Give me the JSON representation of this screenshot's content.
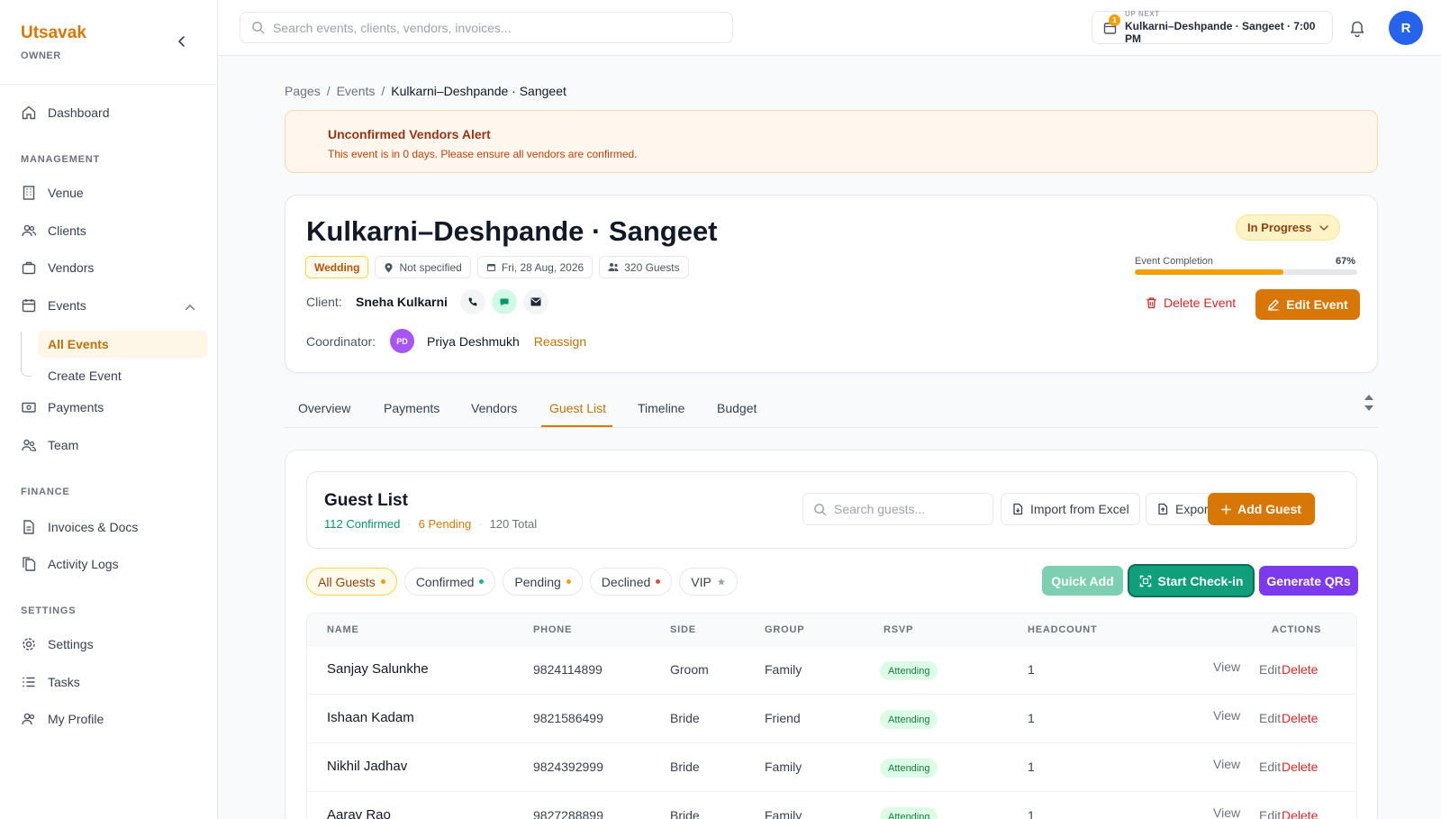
{
  "brand": {
    "name": "Utsavak",
    "role": "OWNER"
  },
  "sidebar": {
    "dashboard": "Dashboard",
    "management_label": "MANAGEMENT",
    "venue": "Venue",
    "clients": "Clients",
    "vendors": "Vendors",
    "events": "Events",
    "all_events": "All Events",
    "create_event": "Create Event",
    "payments": "Payments",
    "team": "Team",
    "finance_label": "FINANCE",
    "invoices": "Invoices & Docs",
    "activity": "Activity Logs",
    "settings_label": "SETTINGS",
    "settings": "Settings",
    "tasks": "Tasks",
    "profile": "My Profile"
  },
  "topbar": {
    "search_placeholder": "Search events, clients, vendors, invoices...",
    "upnext_label": "UP NEXT",
    "upnext_value": "Kulkarni–Deshpande · Sangeet · 7:00 PM",
    "upnext_badge": "1",
    "avatar": "R"
  },
  "breadcrumb": {
    "p1": "Pages",
    "p2": "Events",
    "current": "Kulkarni–Deshpande · Sangeet",
    "sep": "/"
  },
  "alert": {
    "title": "Unconfirmed Vendors Alert",
    "text": "This event is in 0 days. Please ensure all vendors are confirmed."
  },
  "event": {
    "title": "Kulkarni–Deshpande · Sangeet",
    "type": "Wedding",
    "venue": "Not specified",
    "date": "Fri, 28 Aug, 2026",
    "guests": "320 Guests",
    "client_label": "Client:",
    "client_name": "Sneha Kulkarni",
    "coord_label": "Coordinator:",
    "coord_initials": "PD",
    "coord_name": "Priya Deshmukh",
    "reassign": "Reassign",
    "status": "In Progress",
    "completion_label": "Event Completion",
    "completion_text": "67%",
    "completion_value": 0.67,
    "delete": "Delete Event",
    "edit": "Edit Event"
  },
  "tabs": [
    "Overview",
    "Payments",
    "Vendors",
    "Guest List",
    "Timeline",
    "Budget"
  ],
  "guest_list": {
    "title": "Guest List",
    "confirmed": "112 Confirmed",
    "pending": "6 Pending",
    "total": "120 Total",
    "sep": "·",
    "search_placeholder": "Search guests...",
    "import": "Import from Excel",
    "export": "Export",
    "add": "Add Guest",
    "filters": [
      "All Guests",
      "Confirmed",
      "Pending",
      "Declined",
      "VIP"
    ],
    "quick_add": "Quick Add",
    "checkin": "Start Check-in",
    "qrs": "Generate QRs",
    "columns": [
      "NAME",
      "PHONE",
      "SIDE",
      "GROUP",
      "RSVP",
      "HEADCOUNT",
      "ACTIONS"
    ],
    "actions": {
      "view": "View",
      "edit": "Edit",
      "delete": "Delete"
    },
    "rows": [
      {
        "name": "Sanjay Salunkhe",
        "phone": "9824114899",
        "side": "Groom",
        "group": "Family",
        "rsvp": "Attending",
        "headcount": "1"
      },
      {
        "name": "Ishaan Kadam",
        "phone": "9821586499",
        "side": "Bride",
        "group": "Friend",
        "rsvp": "Attending",
        "headcount": "1"
      },
      {
        "name": "Nikhil Jadhav",
        "phone": "9824392999",
        "side": "Bride",
        "group": "Family",
        "rsvp": "Attending",
        "headcount": "1"
      },
      {
        "name": "Aarav Rao",
        "phone": "9827288899",
        "side": "Bride",
        "group": "Family",
        "rsvp": "Attending",
        "headcount": "1"
      }
    ]
  },
  "colors": {
    "accent": "#d97706",
    "success": "#059669",
    "danger": "#dc2626",
    "purple": "#7c3aed",
    "teal": "#0f9f7a"
  }
}
